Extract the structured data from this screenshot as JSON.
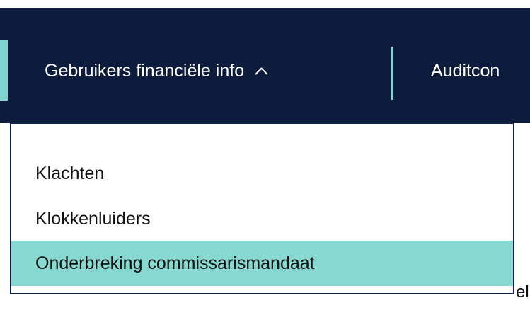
{
  "navigation": {
    "financial_info_label": "Gebruikers financiële info",
    "audit_label": "Auditcon"
  },
  "dropdown": {
    "items": [
      {
        "label": "Klachten"
      },
      {
        "label": "Klokkenluiders"
      },
      {
        "label": "Onderbreking commissarismandaat"
      }
    ]
  },
  "background_text": {
    "right_edge": "el"
  },
  "colors": {
    "navbar": "#0d1b3d",
    "accent": "#7fd6cf",
    "selected_item": "#86d8d1",
    "text_dark": "#111111",
    "text_light": "#ffffff"
  },
  "icons": {
    "dropdown_indicator": "chevron-up-icon"
  }
}
